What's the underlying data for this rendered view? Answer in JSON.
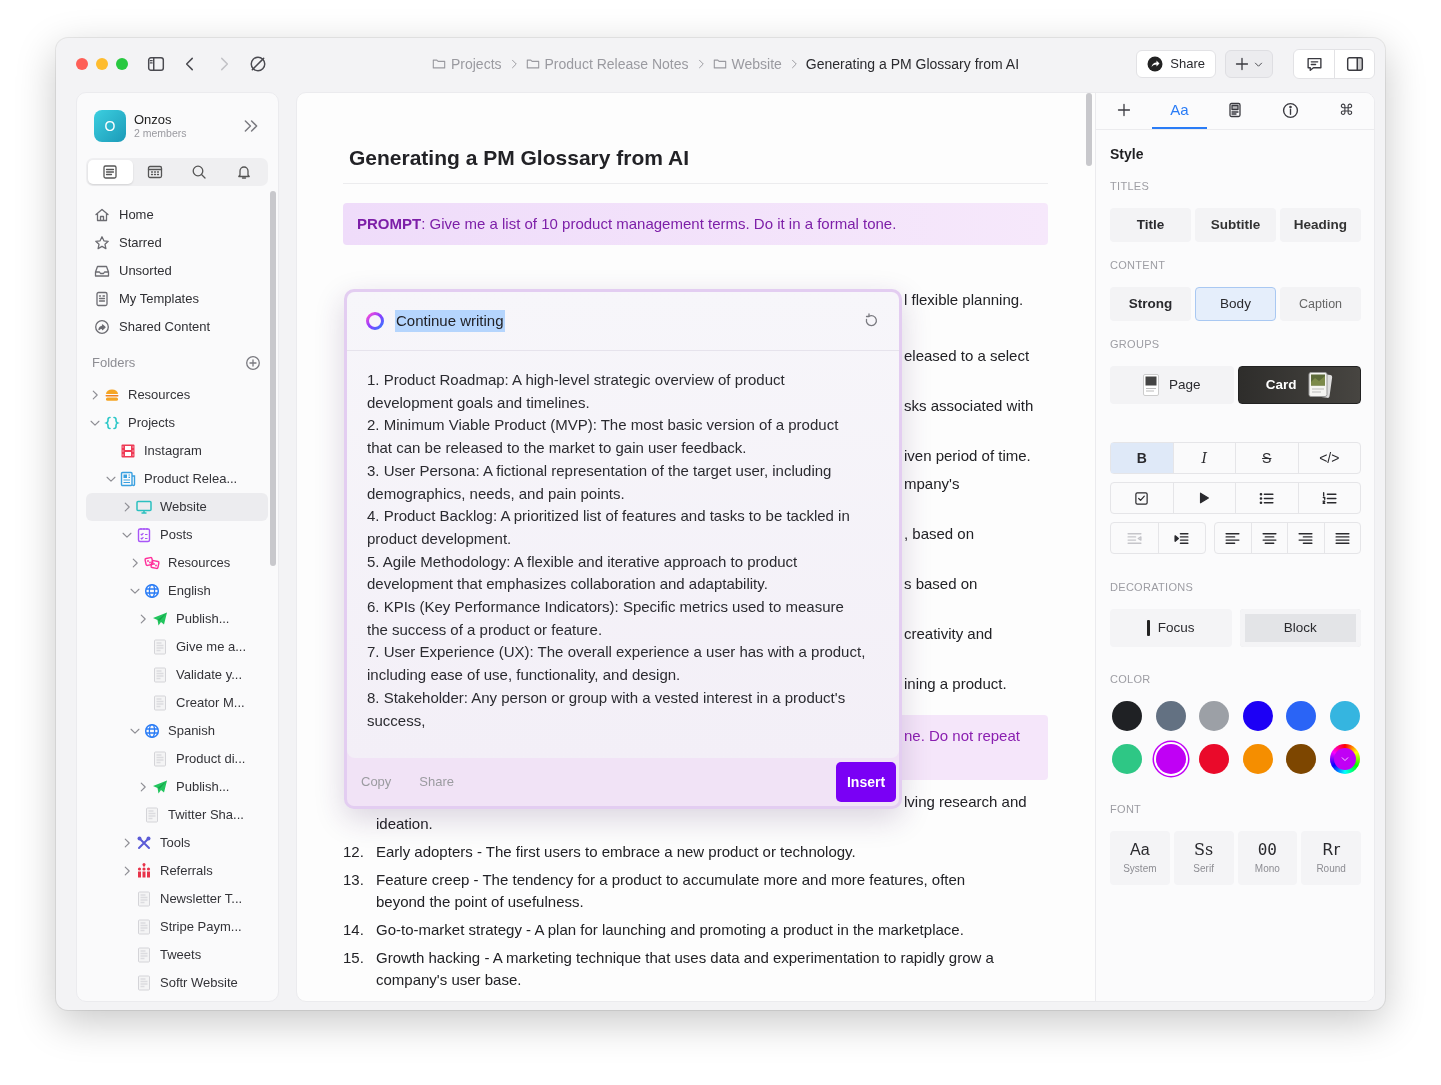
{
  "toolbar": {
    "back": {
      "disabled": false
    },
    "forward": {
      "disabled": true
    }
  },
  "breadcrumb": [
    {
      "label": "Projects",
      "kind": "folder"
    },
    {
      "label": "Product Release Notes",
      "kind": "folder"
    },
    {
      "label": "Website",
      "kind": "folder"
    },
    {
      "label": "Generating a PM Glossary from AI",
      "kind": "current"
    }
  ],
  "share_button": {
    "label": "Share"
  },
  "sidebar": {
    "workspace": {
      "initial": "O",
      "name": "Onzos",
      "members": "2 members"
    },
    "tabs": [
      {
        "kind": "notes",
        "selected": true
      },
      {
        "kind": "calendar",
        "selected": false
      },
      {
        "kind": "search",
        "selected": false
      },
      {
        "kind": "bell",
        "selected": false
      }
    ],
    "nav": [
      {
        "label": "Home",
        "kind": "home"
      },
      {
        "label": "Starred",
        "kind": "star"
      },
      {
        "label": "Unsorted",
        "kind": "inbox"
      },
      {
        "label": "My Templates",
        "kind": "template"
      },
      {
        "label": "Shared Content",
        "kind": "shared"
      }
    ],
    "folders_title": "Folders",
    "tree": [
      {
        "label": "Resources",
        "kind": "burger",
        "expanded": false,
        "selected": false
      },
      {
        "label": "Projects",
        "kind": "braces",
        "expanded": true,
        "selected": false,
        "children": [
          {
            "label": "Instagram",
            "kind": "film",
            "selected": false
          },
          {
            "label": "Product Relea...",
            "kind": "newspaper",
            "expanded": true,
            "selected": false,
            "children": [
              {
                "label": "Website",
                "kind": "monitor",
                "expanded": false,
                "selected": true
              },
              {
                "label": "Posts",
                "kind": "checklist",
                "expanded": true,
                "selected": false,
                "children": [
                  {
                    "label": "Resources",
                    "kind": "dice",
                    "expanded": false,
                    "selected": false
                  },
                  {
                    "label": "English",
                    "kind": "globe",
                    "expanded": true,
                    "selected": false,
                    "children": [
                      {
                        "label": "Publish...",
                        "kind": "plane",
                        "expanded": false,
                        "selected": false
                      },
                      {
                        "label": "Give me a...",
                        "kind": "doc",
                        "selected": false
                      },
                      {
                        "label": "Validate y...",
                        "kind": "doc",
                        "selected": false
                      },
                      {
                        "label": "Creator M...",
                        "kind": "doc",
                        "selected": false
                      }
                    ]
                  },
                  {
                    "label": "Spanish",
                    "kind": "globe",
                    "expanded": true,
                    "selected": false,
                    "children": [
                      {
                        "label": "Product di...",
                        "kind": "doc",
                        "selected": false
                      },
                      {
                        "label": "Publish...",
                        "kind": "plane",
                        "expanded": false,
                        "selected": false
                      }
                    ]
                  },
                  {
                    "label": "Twitter Sha...",
                    "kind": "doc",
                    "selected": false
                  }
                ]
              },
              {
                "label": "Tools",
                "kind": "tools",
                "expanded": false,
                "selected": false
              },
              {
                "label": "Referrals",
                "kind": "people",
                "expanded": false,
                "selected": false
              },
              {
                "label": "Newsletter T...",
                "kind": "doc",
                "selected": false
              },
              {
                "label": "Stripe Paym...",
                "kind": "doc",
                "selected": false
              },
              {
                "label": "Tweets",
                "kind": "doc",
                "selected": false
              },
              {
                "label": "Softr Website",
                "kind": "doc",
                "selected": false
              }
            ]
          }
        ]
      }
    ]
  },
  "document": {
    "title": "Generating a PM Glossary from AI",
    "prompt": "**PROMPT**: Give me a list of 10 product management terms. Do it in a formal tone.",
    "fragments": [
      {
        "kind": "text",
        "text": "l flexible planning."
      },
      {
        "kind": "text",
        "text": "eleased to a select"
      },
      {
        "kind": "text",
        "text": "sks associated with"
      },
      {
        "kind": "text",
        "text": "iven period of time."
      },
      {
        "kind": "text",
        "text": "mpany's"
      },
      {
        "kind": "text",
        "text": ", based on"
      },
      {
        "kind": "text",
        "text": "s based on"
      },
      {
        "kind": "text",
        "text": "creativity and"
      },
      {
        "kind": "text",
        "text": "ining a product."
      },
      {
        "kind": "prompt",
        "text": "ne. Do not repeat"
      },
      {
        "kind": "text",
        "text": "lving research and"
      }
    ],
    "continuation": "ideation.",
    "items": [
      {
        "number": "12.",
        "text": "Early adopters - The first users to embrace a new product or technology."
      },
      {
        "number": "13.",
        "text": "Feature creep - The tendency for a product to accumulate more and more features, often beyond the point of usefulness."
      },
      {
        "number": "14.",
        "text": "Go-to-market strategy - A plan for launching and promoting a product in the marketplace."
      },
      {
        "number": "15.",
        "text": "Growth hacking - A marketing technique that uses data and experimentation to rapidly grow a company's user base."
      }
    ]
  },
  "ai_popup": {
    "action": "Continue writing",
    "lines": [
      "1. Product Roadmap: A high-level strategic overview of product development goals and timelines.",
      "2. Minimum Viable Product (MVP): The most basic version of a product that can be released to the market to gain user feedback.",
      "3. User Persona: A fictional representation of the target user, including demographics, needs, and pain points.",
      "4. Product Backlog: A prioritized list of features and tasks to be tackled in product development.",
      "5. Agile Methodology: A flexible and iterative approach to product development that emphasizes collaboration and adaptability.",
      "6. KPIs (Key Performance Indicators): Specific metrics used to measure the success of a product or feature.",
      "7. User Experience (UX): The overall experience a user has with a product, including ease of use, functionality, and design.",
      "8. Stakeholder: Any person or group with a vested interest in a product's success,"
    ],
    "copy": "Copy",
    "share": "Share",
    "insert": "Insert"
  },
  "style_panel": {
    "tabs": [
      {
        "kind": "plus",
        "selected": false
      },
      {
        "kind": "text",
        "label": "Aa",
        "selected": true
      },
      {
        "kind": "card",
        "selected": false
      },
      {
        "kind": "info",
        "selected": false
      },
      {
        "kind": "text",
        "label": "⌘",
        "selected": false
      }
    ],
    "title": "Style",
    "sections": [
      {
        "heading": "TITLES",
        "options": [
          {
            "label": "Title",
            "kind": "title",
            "selected": false
          },
          {
            "label": "Subtitle",
            "kind": "subtitle",
            "selected": false
          },
          {
            "label": "Heading",
            "kind": "heading",
            "selected": false
          }
        ]
      },
      {
        "heading": "CONTENT",
        "options": [
          {
            "label": "Strong",
            "kind": "strong",
            "selected": false
          },
          {
            "label": "Body",
            "kind": "body",
            "selected": true
          },
          {
            "label": "Caption",
            "kind": "caption",
            "selected": false
          }
        ]
      },
      {
        "heading": "GROUPS",
        "options": [
          {
            "label": "Page",
            "kind": "page",
            "selected": false
          },
          {
            "label": "Card",
            "kind": "card",
            "selected": true
          }
        ]
      }
    ],
    "marks": [
      {
        "kind": "bold",
        "label": "B",
        "selected": true
      },
      {
        "kind": "italic",
        "label": "I",
        "selected": false
      },
      {
        "kind": "strike",
        "label": "S",
        "selected": false
      },
      {
        "kind": "code",
        "label": "</>",
        "selected": false
      }
    ],
    "blocks": [
      {
        "kind": "checkbox"
      },
      {
        "kind": "play"
      },
      {
        "kind": "bullets"
      },
      {
        "kind": "numbers"
      }
    ],
    "indent": [
      {
        "kind": "outdent",
        "disabled": true
      },
      {
        "kind": "indent",
        "disabled": false
      }
    ],
    "align": [
      {
        "kind": "left"
      },
      {
        "kind": "center"
      },
      {
        "kind": "right"
      },
      {
        "kind": "justify"
      }
    ],
    "decorations": {
      "heading": "DECORATIONS",
      "options": [
        {
          "label": "Focus",
          "kind": "focus",
          "selected": false
        },
        {
          "label": "Block",
          "kind": "block",
          "selected": true
        }
      ]
    },
    "colors": {
      "heading": "COLOR",
      "swatches": [
        {
          "kind": "swatch",
          "color": "#1f2124",
          "selected": false
        },
        {
          "kind": "swatch",
          "color": "#637182",
          "selected": false
        },
        {
          "kind": "swatch",
          "color": "#9ca0a6",
          "selected": false
        },
        {
          "kind": "swatch",
          "color": "#1d00f5",
          "selected": false
        },
        {
          "kind": "swatch",
          "color": "#2a64f6",
          "selected": false
        },
        {
          "kind": "swatch",
          "color": "#35b5e0",
          "selected": false
        },
        {
          "kind": "swatch",
          "color": "#2ec785",
          "selected": false
        },
        {
          "kind": "swatch",
          "color": "#c000f5",
          "selected": true
        },
        {
          "kind": "swatch",
          "color": "#ea0a2a",
          "selected": false
        },
        {
          "kind": "swatch",
          "color": "#f58e00",
          "selected": false
        },
        {
          "kind": "swatch",
          "color": "#7d4600",
          "selected": false
        },
        {
          "kind": "picker",
          "selected": false
        }
      ]
    },
    "fonts": {
      "heading": "FONT",
      "options": [
        {
          "sample": "Aa",
          "label": "System",
          "kind": "system"
        },
        {
          "sample": "Ss",
          "label": "Serif",
          "kind": "serif"
        },
        {
          "sample": "00",
          "label": "Mono",
          "kind": "mono"
        },
        {
          "sample": "Rr",
          "label": "Round",
          "kind": "round"
        }
      ]
    }
  }
}
